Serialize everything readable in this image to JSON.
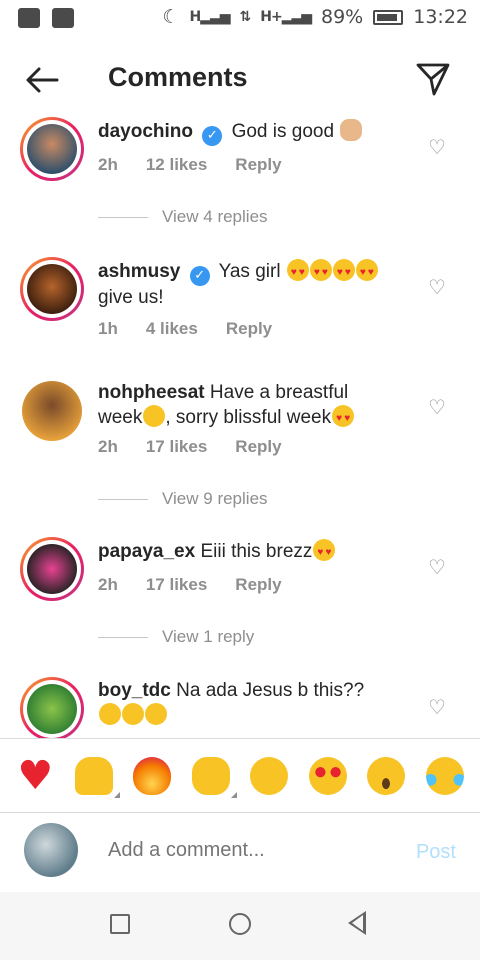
{
  "status_bar": {
    "battery": "89%",
    "time": "13:22",
    "signal_1": "H",
    "signal_2": "H+"
  },
  "header": {
    "title": "Comments"
  },
  "comments": [
    {
      "username": "dayochino",
      "verified": true,
      "text": "God is good",
      "time": "2h",
      "likes": "12 likes",
      "reply": "Reply",
      "view_replies": "View 4 replies"
    },
    {
      "username": "ashmusy",
      "verified": true,
      "text": "Yas girl",
      "text_line2": "give us!",
      "time": "1h",
      "likes": "4 likes",
      "reply": "Reply"
    },
    {
      "username": "nohpheesat",
      "verified": false,
      "text": "Have a breastful",
      "text_line2": "week",
      "text_line2_b": ", sorry blissful week",
      "time": "2h",
      "likes": "17 likes",
      "reply": "Reply",
      "view_replies": "View 9 replies"
    },
    {
      "username": "papaya_ex",
      "verified": false,
      "text": "Eiii this brezz",
      "time": "2h",
      "likes": "17 likes",
      "reply": "Reply",
      "view_replies": "View 1 reply"
    },
    {
      "username": "boy_tdc",
      "verified": false,
      "text": "Na ada Jesus b this??"
    }
  ],
  "emoji_bar": [
    "heart",
    "raised-hands",
    "fire",
    "clapping-hands",
    "crying-face",
    "heart-eyes",
    "astonished-face",
    "tears-of-joy"
  ],
  "add_comment": {
    "placeholder": "Add a comment...",
    "post_label": "Post"
  },
  "colors": {
    "accent": "#3897f0",
    "post_disabled": "#b2dffc",
    "muted": "#8e8e8e"
  }
}
